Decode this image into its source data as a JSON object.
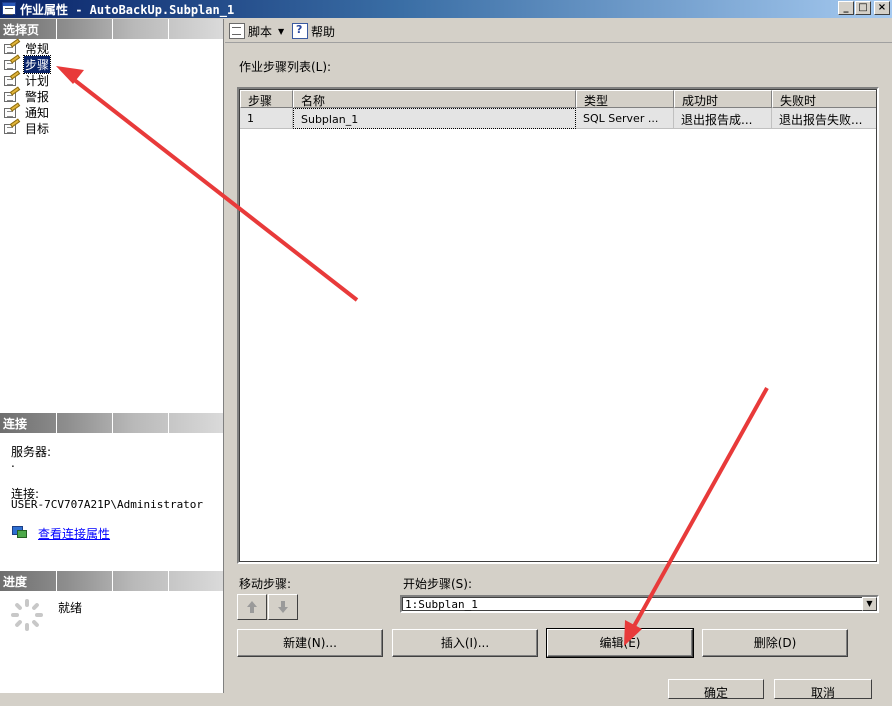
{
  "window": {
    "title": "作业属性 - AutoBackUp.Subplan_1",
    "minimize_glyph": "_",
    "maximize_glyph": "□",
    "close_glyph": "×"
  },
  "left_panel": {
    "select_page_header": "选择页",
    "pages": [
      {
        "label": "常规",
        "selected": false
      },
      {
        "label": "步骤",
        "selected": true
      },
      {
        "label": "计划",
        "selected": false
      },
      {
        "label": "警报",
        "selected": false
      },
      {
        "label": "通知",
        "selected": false
      },
      {
        "label": "目标",
        "selected": false
      }
    ],
    "connection_header": "连接",
    "server_label": "服务器:",
    "server_value": ".",
    "connection_label": "连接:",
    "connection_value": "USER-7CV707A21P\\Administrator",
    "view_connection_link": "查看连接属性",
    "progress_header": "进度",
    "progress_status": "就绪"
  },
  "toolbar": {
    "script_label": "脚本",
    "help_label": "帮助"
  },
  "main": {
    "step_list_label": "作业步骤列表(L):",
    "columns": [
      "步骤",
      "名称",
      "类型",
      "成功时",
      "失败时"
    ],
    "rows": [
      {
        "step": "1",
        "name": "Subplan_1",
        "type": "SQL Server ...",
        "on_success": "退出报告成...",
        "on_failure": "退出报告失败..."
      }
    ],
    "move_step_label": "移动步骤:",
    "start_step_label": "开始步骤(S):",
    "start_step_value": "1:Subplan_1",
    "buttons": {
      "new": "新建(N)...",
      "insert": "插入(I)...",
      "edit": "编辑(E)",
      "delete": "删除(D)"
    }
  },
  "dialog_buttons": {
    "ok": "确定",
    "cancel": "取消"
  },
  "colors": {
    "annotation_arrow": "#e83a3a",
    "selection": "#0a246a",
    "link": "#0000ff"
  }
}
